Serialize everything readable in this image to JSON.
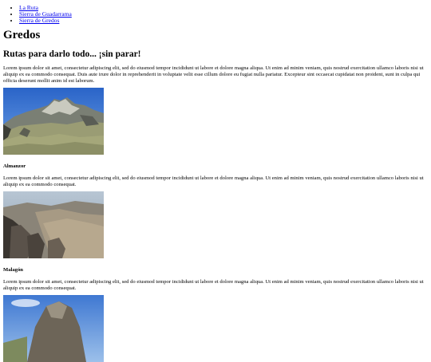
{
  "nav": {
    "items": [
      "La Ruta",
      "Sierra de Guadarrama",
      "Sierra de Gredos"
    ]
  },
  "main": {
    "title": "Gredos",
    "subtitle": "Rutas para darlo todo... ¡sin parar!",
    "intro": "Lorem ipsum dolor sit amet, consectetur adipiscing elit, sed do eiusmod tempor incididunt ut labore et dolore magna aliqua. Ut enim ad minim veniam, quis nostrud exercitation ullamco laboris nisi ut aliquip ex ea commodo consequat. Duis aute irure dolor in reprehenderit in voluptate velit esse cillum dolore eu fugiat nulla pariatur. Excepteur sint occaecat cupidatat non proident, sunt in culpa qui officia deserunt mollit anim id est laborum.",
    "peaks": [
      {
        "name": "Almanzor",
        "text": "Lorem ipsum dolor sit amet, consectetur adipiscing elit, sed do eiusmod tempor incididunt ut labore et dolore magna aliqua. Ut enim ad minim veniam, quis nostrud exercitation ullamco laboris nisi ut aliquip ex ea commodo consequat."
      },
      {
        "name": "Malagón",
        "text": "Lorem ipsum dolor sit amet, consectetur adipiscing elit, sed do eiusmod tempor incididunt ut labore et dolore magna aliqua. Ut enim ad minim veniam, quis nostrud exercitation ullamco laboris nisi ut aliquip ex ea commodo consequat."
      }
    ]
  },
  "colors": {
    "link": "#0000ee",
    "text": "#000000",
    "background": "#ffffff"
  }
}
